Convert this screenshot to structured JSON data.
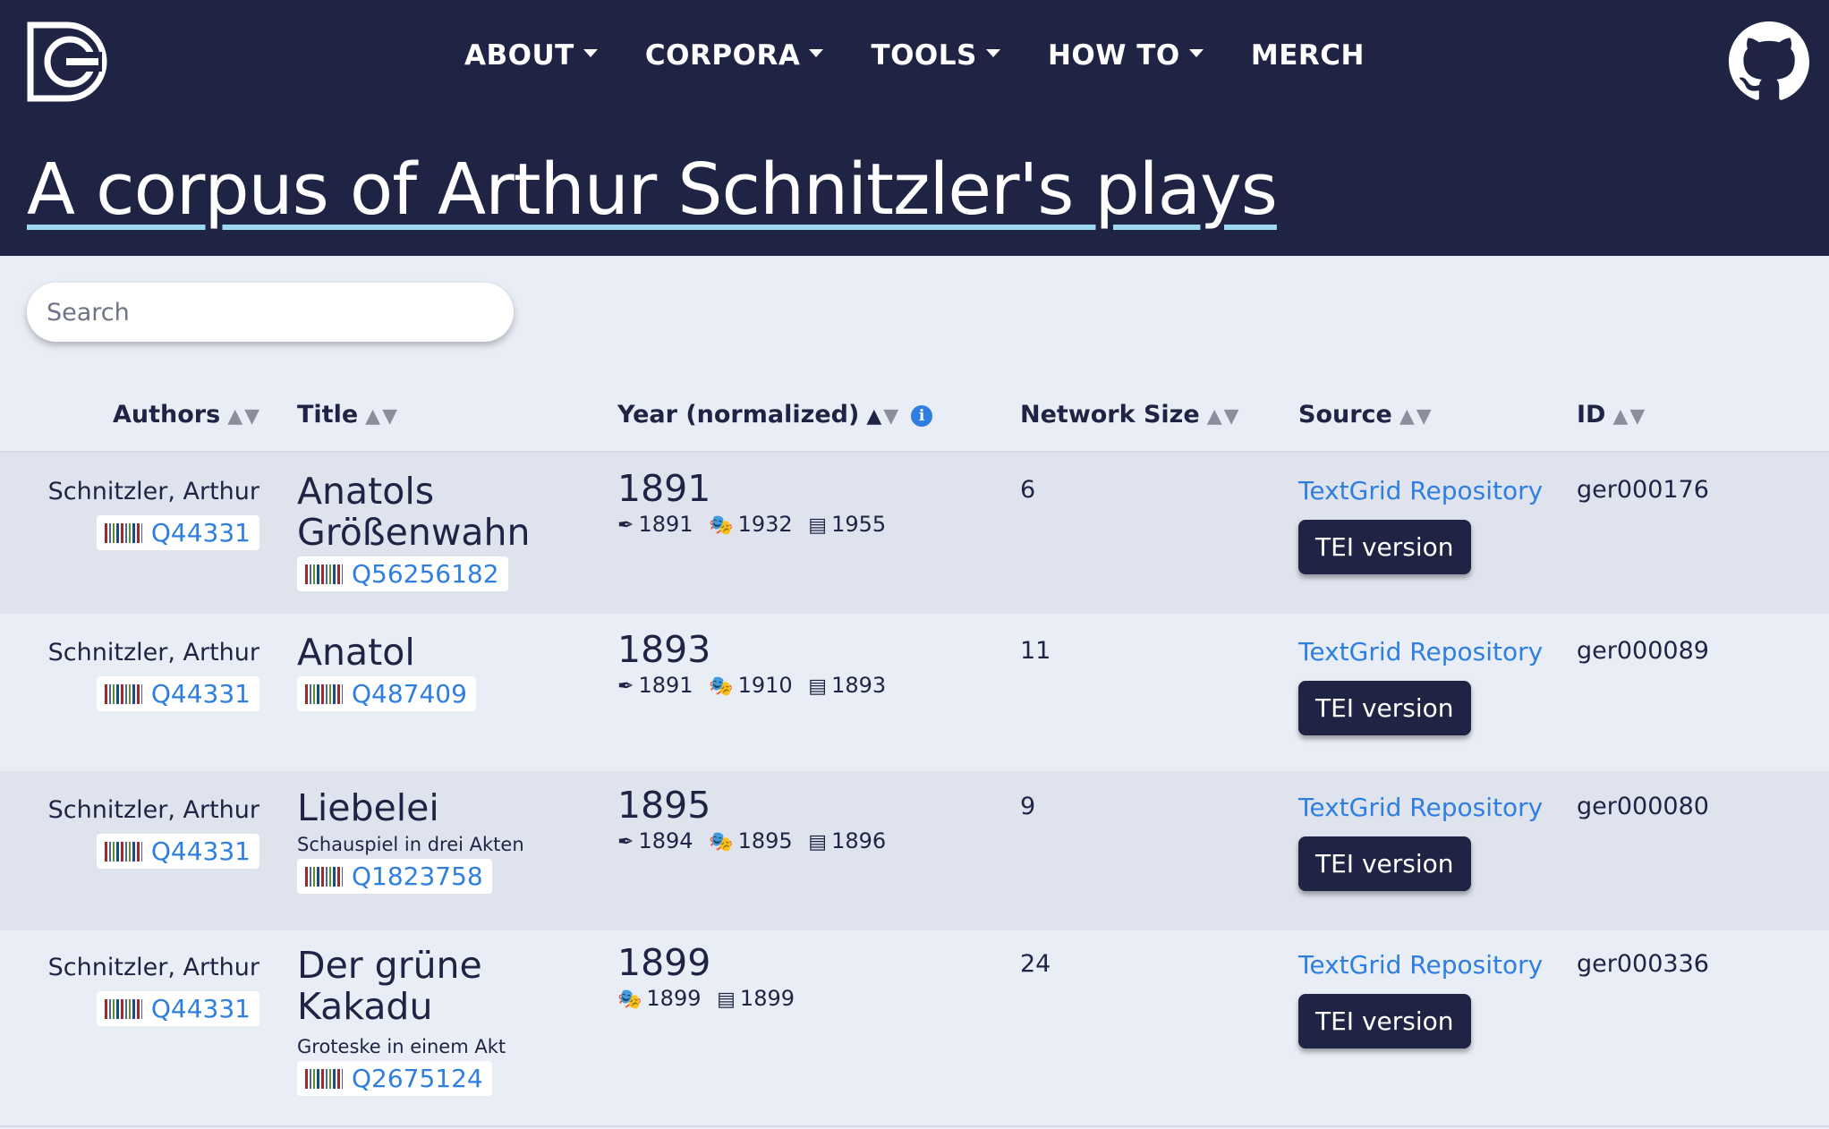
{
  "nav": {
    "items": [
      {
        "label": "ABOUT",
        "dropdown": true
      },
      {
        "label": "CORPORA",
        "dropdown": true
      },
      {
        "label": "TOOLS",
        "dropdown": true
      },
      {
        "label": "HOW TO",
        "dropdown": true
      },
      {
        "label": "MERCH",
        "dropdown": false
      }
    ]
  },
  "icons": {
    "logo": "dracor-logo-icon",
    "github": "github-icon",
    "info": "info-icon",
    "barcode": "wikidata-barcode-icon",
    "written": "pen-icon",
    "premiere": "theatre-masks-icon",
    "printed": "book-icon"
  },
  "page": {
    "title": "A corpus of Arthur Schnitzler's plays"
  },
  "search": {
    "placeholder": "Search"
  },
  "table": {
    "columns": {
      "authors": "Authors",
      "title": "Title",
      "year": "Year (normalized)",
      "network": "Network Size",
      "source": "Source",
      "id": "ID"
    },
    "rows": [
      {
        "author": "Schnitzler, Arthur",
        "author_q": "Q44331",
        "title_line1": "Anatols",
        "title_line2": "Größenwahn",
        "subtitle": "",
        "title_q": "Q56256182",
        "year": "1891",
        "written": "1891",
        "premiere": "1932",
        "printed": "1955",
        "network": "6",
        "source": "TextGrid Repository",
        "tei": "TEI version",
        "id": "ger000176"
      },
      {
        "author": "Schnitzler, Arthur",
        "author_q": "Q44331",
        "title_line1": "Anatol",
        "title_line2": "",
        "subtitle": "",
        "title_q": "Q487409",
        "year": "1893",
        "written": "1891",
        "premiere": "1910",
        "printed": "1893",
        "network": "11",
        "source": "TextGrid Repository",
        "tei": "TEI version",
        "id": "ger000089"
      },
      {
        "author": "Schnitzler, Arthur",
        "author_q": "Q44331",
        "title_line1": "Liebelei",
        "title_line2": "",
        "subtitle": "Schauspiel in drei Akten",
        "title_q": "Q1823758",
        "year": "1895",
        "written": "1894",
        "premiere": "1895",
        "printed": "1896",
        "network": "9",
        "source": "TextGrid Repository",
        "tei": "TEI version",
        "id": "ger000080"
      },
      {
        "author": "Schnitzler, Arthur",
        "author_q": "Q44331",
        "title_line1": "Der grüne",
        "title_line2": "Kakadu",
        "subtitle": "Groteske in einem Akt",
        "title_q": "Q2675124",
        "year": "1899",
        "written": "",
        "premiere": "1899",
        "printed": "1899",
        "network": "24",
        "source": "TextGrid Repository",
        "tei": "TEI version",
        "id": "ger000336"
      }
    ]
  }
}
